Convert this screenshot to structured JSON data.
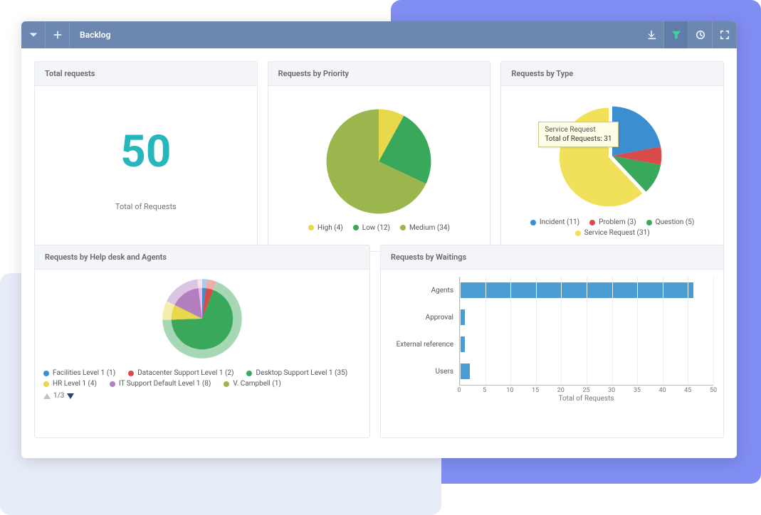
{
  "toolbar": {
    "title": "Backlog"
  },
  "cards": {
    "total": {
      "title": "Total requests",
      "value": "50",
      "label": "Total of Requests"
    },
    "priority": {
      "title": "Requests by Priority"
    },
    "type": {
      "title": "Requests by Type",
      "tooltip_name": "Service Request",
      "tooltip_val": "Total of Requests: 31"
    },
    "helpdesk": {
      "title": "Requests by Help desk and Agents",
      "pager": "1/3"
    },
    "waitings": {
      "title": "Requests by Waitings",
      "axis_label": "Total of Requests"
    }
  },
  "legends": {
    "priority": [
      {
        "label": "High (4)",
        "color": "#e8d84b"
      },
      {
        "label": "Low (12)",
        "color": "#3aa85a"
      },
      {
        "label": "Medium (34)",
        "color": "#9ab64d"
      }
    ],
    "type": [
      {
        "label": "Incident (11)",
        "color": "#3b8fd0"
      },
      {
        "label": "Problem (3)",
        "color": "#d94a4a"
      },
      {
        "label": "Question (5)",
        "color": "#3aa85a"
      },
      {
        "label": "Service Request (31)",
        "color": "#f1e15a"
      }
    ],
    "helpdesk": [
      {
        "label": "Facilities Level 1 (1)",
        "color": "#3b8fd0"
      },
      {
        "label": "Datacenter Support Level 1 (2)",
        "color": "#d94a4a"
      },
      {
        "label": "Desktop Support Level 1 (35)",
        "color": "#3aa85a"
      },
      {
        "label": "HR Level 1 (4)",
        "color": "#e8d84b"
      },
      {
        "label": "IT Support Default Level 1 (8)",
        "color": "#b27fbf"
      },
      {
        "label": "V. Campbell (1)",
        "color": "#9ab64d"
      }
    ]
  },
  "chart_data": [
    {
      "type": "pie",
      "title": "Requests by Priority",
      "series": [
        {
          "name": "High",
          "value": 4,
          "color": "#e8d84b"
        },
        {
          "name": "Low",
          "value": 12,
          "color": "#3aa85a"
        },
        {
          "name": "Medium",
          "value": 34,
          "color": "#9ab64d"
        }
      ]
    },
    {
      "type": "pie",
      "title": "Requests by Type",
      "series": [
        {
          "name": "Incident",
          "value": 11,
          "color": "#3b8fd0"
        },
        {
          "name": "Problem",
          "value": 3,
          "color": "#d94a4a"
        },
        {
          "name": "Question",
          "value": 5,
          "color": "#3aa85a"
        },
        {
          "name": "Service Request",
          "value": 31,
          "color": "#f1e15a",
          "offset": 6
        }
      ]
    },
    {
      "type": "pie",
      "title": "Requests by Help desk and Agents (outer)",
      "series": [
        {
          "name": "Facilities Level 1",
          "value": 1,
          "color": "#3b8fd0"
        },
        {
          "name": "Datacenter Support Level 1",
          "value": 2,
          "color": "#d94a4a"
        },
        {
          "name": "Desktop Support Level 1",
          "value": 35,
          "color": "#3aa85a"
        },
        {
          "name": "HR Level 1",
          "value": 4,
          "color": "#e8d84b"
        },
        {
          "name": "IT Support Default Level 1",
          "value": 8,
          "color": "#b27fbf"
        },
        {
          "name": "V. Campbell",
          "value": 1,
          "color": "#f3b7e8"
        }
      ]
    },
    {
      "type": "bar",
      "title": "Requests by Waitings",
      "xlabel": "Total of Requests",
      "xlim": [
        0,
        50
      ],
      "ticks": [
        0,
        5,
        10,
        15,
        20,
        25,
        30,
        35,
        40,
        45,
        50
      ],
      "categories": [
        "Agents",
        "Approval",
        "External reference",
        "Users"
      ],
      "values": [
        46,
        1,
        1,
        2
      ],
      "color": "#4a9dd1"
    }
  ]
}
